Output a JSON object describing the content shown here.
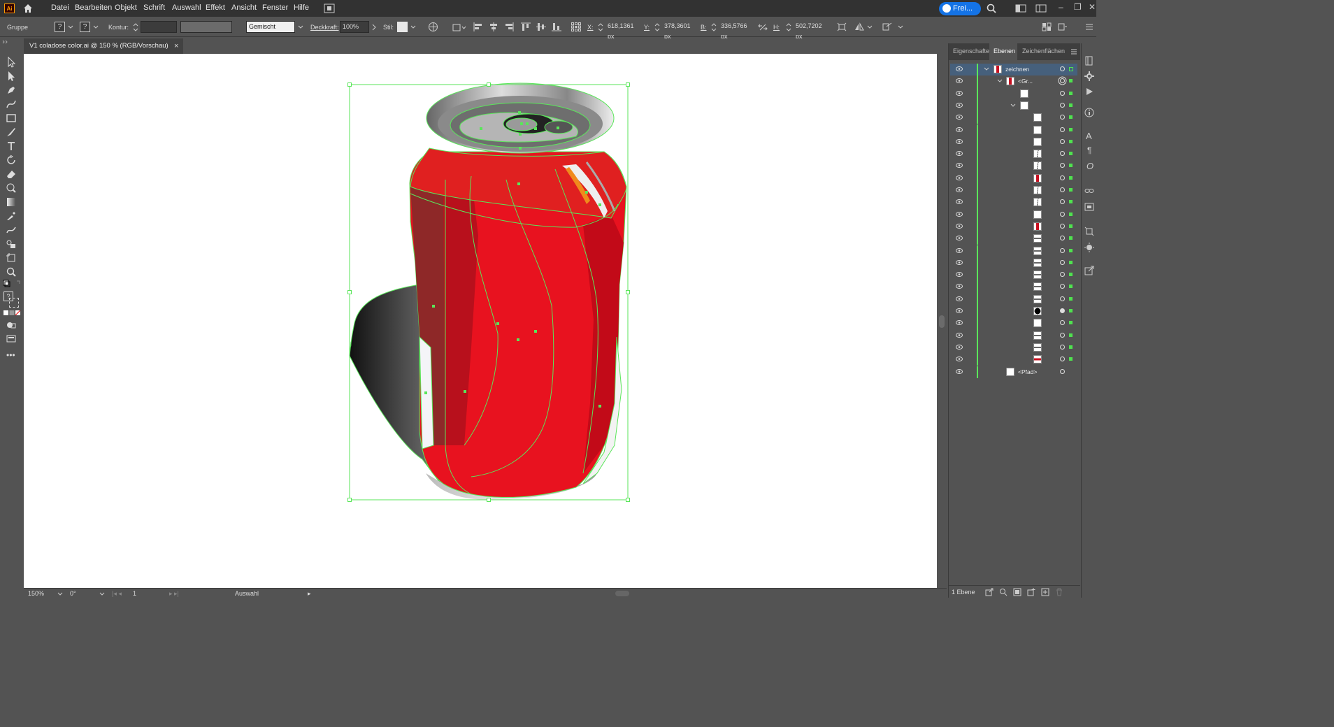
{
  "app": {
    "logo_text": "Ai",
    "share_label": "Frei..."
  },
  "menu": [
    "Datei",
    "Bearbeiten",
    "Objekt",
    "Schrift",
    "Auswahl",
    "Effekt",
    "Ansicht",
    "Fenster",
    "Hilfe"
  ],
  "control": {
    "selection_type": "Gruppe",
    "kontur_label": "Kontur:",
    "stroke_style": "Gemischt",
    "opacity_label": "Deckkraft:",
    "opacity_value": "100%",
    "style_label": "Stil:",
    "x_label": "X:",
    "x_value": "618,1361 px",
    "y_label": "Y:",
    "y_value": "378,3601 px",
    "w_label": "B:",
    "w_value": "336,5766 px",
    "h_label": "H:",
    "h_value": "502,7202 px",
    "q_mark": "?"
  },
  "document_tab": {
    "title": "V1 coladose color.ai @ 150 % (RGB/Vorschau)",
    "close": "×"
  },
  "status": {
    "zoom": "150%",
    "rotation": "0°",
    "artboard": "1",
    "mode": "Auswahl"
  },
  "panel": {
    "tabs": [
      "Eigenschaften",
      "Ebenen",
      "Zeichenflächen"
    ],
    "active_tab": "Ebenen",
    "layer_name": "zeichnen",
    "group_name": "<Gr...",
    "path_name": "<Pfad>",
    "footer_count": "1 Ebene"
  },
  "colors": {
    "can_red": "#e8121f",
    "selection": "#5ae65a",
    "accent": "#1473e6"
  }
}
